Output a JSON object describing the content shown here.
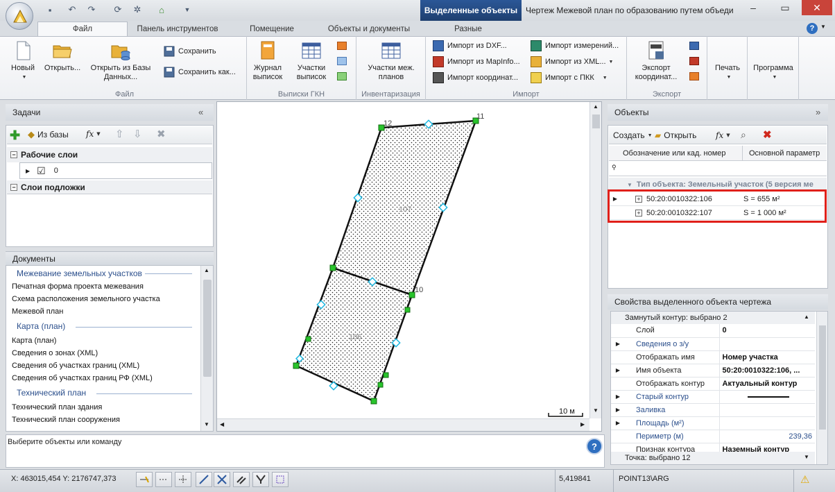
{
  "title_bar": {
    "context_tab": "Выделенные объекты",
    "window_title": "Чертеж Межевой план по образованию путем объедин..."
  },
  "ribbon_tabs": [
    "Файл",
    "Панель инструментов",
    "Помещение",
    "Объекты и документы",
    "Разные"
  ],
  "ribbon": {
    "file_group": {
      "label": "Файл",
      "new": "Новый",
      "open": "Открыть...",
      "open_db": "Открыть из Базы Данных...",
      "save": "Сохранить",
      "save_as": "Сохранить как..."
    },
    "gkn_group": {
      "label": "Выписки ГКН",
      "journal": "Журнал выписок",
      "plots": "Участки выписок"
    },
    "inv_group": {
      "label": "Инвентаризация",
      "plans": "Участки меж. планов"
    },
    "import_group": {
      "label": "Импорт",
      "dxf": "Импорт из DXF...",
      "mapinfo": "Импорт из MapInfo...",
      "coords": "Импорт координат...",
      "meas": "Импорт измерений...",
      "xml": "Импорт из XML...",
      "pkk": "Импорт с ПКК"
    },
    "export_group": {
      "label": "Экспорт",
      "export_coords": "Экспорт координат..."
    },
    "print": "Печать",
    "program": "Программа"
  },
  "tasks_panel": {
    "title": "Задачи",
    "from_db": "Из базы",
    "fx": "fx",
    "working_layers": "Рабочие слои",
    "layer_value": "0",
    "base_layers": "Слои подложки"
  },
  "documents_panel": {
    "title": "Документы",
    "sections": [
      {
        "head": "Межевание земельных участков",
        "items": [
          "Печатная форма проекта межевания",
          "Схема расположения земельного участка",
          "Межевой план"
        ]
      },
      {
        "head": "Карта (план)",
        "items": [
          "Карта (план)",
          "Сведения о зонах (XML)",
          "Сведения об участках границ (XML)",
          "Сведения об участках границ РФ (XML)"
        ]
      },
      {
        "head": "Технический план",
        "items": [
          "Технический план здания",
          "Технический план сооружения"
        ]
      }
    ]
  },
  "drawing": {
    "point_labels": [
      "12",
      "11",
      "10"
    ],
    "parcel_labels": [
      "107",
      "106"
    ],
    "scale_label": "10 м"
  },
  "objects_panel": {
    "title": "Объекты",
    "create": "Создать",
    "open": "Открыть",
    "col1": "Обозначение или кад. номер",
    "col2": "Основной параметр",
    "group_row": "Тип объекта: Земельный участок (5 версия ме",
    "rows": [
      {
        "id": "50:20:0010322:106",
        "param": "S = 655 м²"
      },
      {
        "id": "50:20:0010322:107",
        "param": "S = 1 000 м²"
      }
    ]
  },
  "properties_panel": {
    "title": "Свойства выделенного объекта чертежа",
    "section1": "Замнутый контур: выбрано 2",
    "rows": [
      {
        "name": "Слой",
        "value": "0"
      },
      {
        "name": "Сведения о з/у",
        "value": ""
      },
      {
        "name": "Отображать имя",
        "value": "Номер участка"
      },
      {
        "name": "Имя объекта",
        "value": "50:20:0010322:106, ..."
      },
      {
        "name": "Отображать контур",
        "value": "Актуальный контур"
      },
      {
        "name": "Старый контур",
        "value": ""
      },
      {
        "name": "Заливка",
        "value": ""
      },
      {
        "name": "Площадь (м²)",
        "value": ""
      },
      {
        "name": "Периметр (м)",
        "value": "239,36"
      },
      {
        "name": "Признак контура",
        "value": "Наземный контур"
      }
    ],
    "section2": "Точка: выбрано 12"
  },
  "prompt": "Выберите объекты или команду",
  "status": {
    "coords": "X: 463015,454 Y: 2176747,373",
    "value": "5,419841",
    "point": "POINT13\\ARG"
  },
  "colors": {
    "accent": "#2b5797",
    "highlight": "#e0201a",
    "vertex": "#29c42c",
    "midpoint": "#1fb8e0"
  }
}
